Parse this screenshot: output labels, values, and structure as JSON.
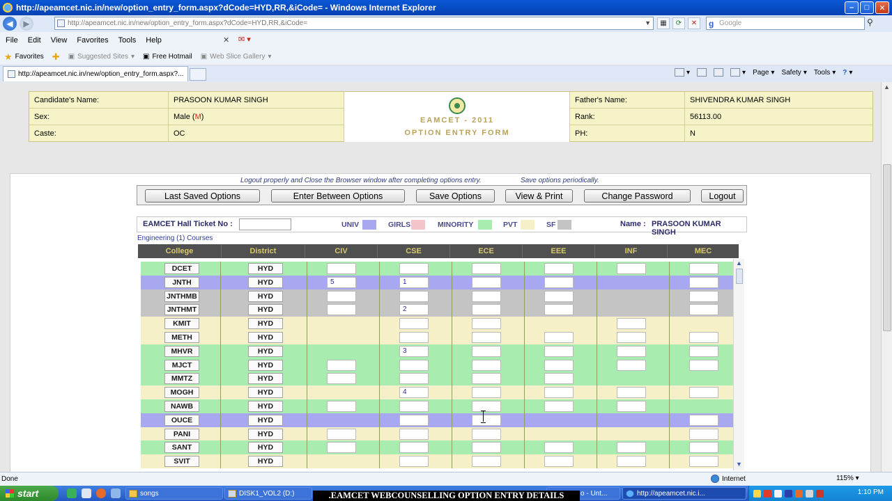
{
  "window": {
    "title": "http://apeamcet.nic.in/new/option_entry_form.aspx?dCode=HYD,RR,&iCode= - Windows Internet Explorer"
  },
  "address_bar": {
    "url": "http://apeamcet.nic.in/new/option_entry_form.aspx?dCode=HYD,RR,&iCode=",
    "search_placeholder": "Google"
  },
  "menu": [
    "File",
    "Edit",
    "View",
    "Favorites",
    "Tools",
    "Help"
  ],
  "favorites_bar": {
    "favorites": "Favorites",
    "suggested_sites": "Suggested Sites",
    "free_hotmail": "Free Hotmail",
    "web_slice_gallery": "Web Slice Gallery"
  },
  "tab": {
    "title": "http://apeamcet.nic.in/new/option_entry_form.aspx?..."
  },
  "command_bar": {
    "page": "Page",
    "safety": "Safety",
    "tools": "Tools"
  },
  "candidate": {
    "name_label": "Candidate's Name:",
    "name": "PRASOON KUMAR SINGH",
    "sex_label": "Sex:",
    "sex_value": "Male (",
    "sex_code": "M",
    "sex_close": ")",
    "caste_label": "Caste:",
    "caste": "OC",
    "father_label": "Father's Name:",
    "father": "SHIVENDRA KUMAR SINGH",
    "rank_label": "Rank:",
    "rank": "56113.00",
    "ph_label": "PH:",
    "ph": "N",
    "form_title_1": "EAMCET  -  2011",
    "form_title_2": "OPTION  ENTRY  FORM"
  },
  "notes": {
    "logout_note": "Logout properly and Close the Browser window after completing options entry.",
    "save_note": "Save options periodically."
  },
  "buttons": {
    "last_saved": "Last Saved Options",
    "enter_between": "Enter Between Options",
    "save": "Save Options",
    "view_print": "View & Print",
    "change_password": "Change Password",
    "logout": "Logout"
  },
  "info": {
    "hall_ticket_label": "EAMCET Hall Ticket No :",
    "legend": [
      {
        "label": "UNIV",
        "color": "#a8a8f0"
      },
      {
        "label": "GIRLS",
        "color": "#f5c4c8"
      },
      {
        "label": "MINORITY",
        "color": "#a8ecb0"
      },
      {
        "label": "PVT",
        "color": "#f5f0c8"
      },
      {
        "label": "SF",
        "color": "#c4c4c4"
      }
    ],
    "name_label": "Name :",
    "name": "PRASOON KUMAR SINGH",
    "courses_caption": "Engineering (1) Courses"
  },
  "grid": {
    "headers": [
      "College",
      "District",
      "CIV",
      "CSE",
      "ECE",
      "EEE",
      "INF",
      "MEC"
    ],
    "rows": [
      {
        "college": "DCET",
        "district": "HYD",
        "type": "MINORITY",
        "cells": [
          "",
          "",
          "",
          "",
          "",
          ""
        ],
        "show": [
          1,
          1,
          1,
          1,
          1,
          1
        ]
      },
      {
        "college": "JNTH",
        "district": "HYD",
        "type": "UNIV",
        "cells": [
          "5",
          "1",
          "",
          "",
          "",
          ""
        ],
        "show": [
          1,
          1,
          1,
          1,
          0,
          1
        ]
      },
      {
        "college": "JNTHMB",
        "district": "HYD",
        "type": "SF",
        "cells": [
          "",
          "",
          "",
          "",
          "",
          ""
        ],
        "show": [
          1,
          1,
          1,
          1,
          0,
          1
        ]
      },
      {
        "college": "JNTHMT",
        "district": "HYD",
        "type": "SF",
        "cells": [
          "",
          "2",
          "",
          "",
          "",
          ""
        ],
        "show": [
          1,
          1,
          1,
          1,
          0,
          1
        ]
      },
      {
        "college": "KMIT",
        "district": "HYD",
        "type": "PVT",
        "cells": [
          "",
          "",
          "",
          "",
          "",
          ""
        ],
        "show": [
          0,
          1,
          1,
          0,
          1,
          0
        ]
      },
      {
        "college": "METH",
        "district": "HYD",
        "type": "PVT",
        "cells": [
          "",
          "",
          "",
          "",
          "",
          ""
        ],
        "show": [
          0,
          1,
          1,
          1,
          1,
          1
        ]
      },
      {
        "college": "MHVR",
        "district": "HYD",
        "type": "MINORITY",
        "cells": [
          "",
          "3",
          "",
          "",
          "",
          ""
        ],
        "show": [
          0,
          1,
          1,
          1,
          1,
          1
        ]
      },
      {
        "college": "MJCT",
        "district": "HYD",
        "type": "MINORITY",
        "cells": [
          "",
          "",
          "",
          "",
          "",
          ""
        ],
        "show": [
          1,
          1,
          1,
          1,
          1,
          1
        ]
      },
      {
        "college": "MMTZ",
        "district": "HYD",
        "type": "MINORITY",
        "cells": [
          "",
          "",
          "",
          "",
          "",
          ""
        ],
        "show": [
          1,
          1,
          1,
          1,
          0,
          0
        ]
      },
      {
        "college": "MOGH",
        "district": "HYD",
        "type": "PVT",
        "cells": [
          "",
          "4",
          "",
          "",
          "",
          ""
        ],
        "show": [
          0,
          1,
          1,
          1,
          1,
          1
        ]
      },
      {
        "college": "NAWB",
        "district": "HYD",
        "type": "MINORITY",
        "cells": [
          "",
          "",
          "",
          "",
          "",
          ""
        ],
        "show": [
          1,
          1,
          1,
          1,
          1,
          0
        ]
      },
      {
        "college": "OUCE",
        "district": "HYD",
        "type": "UNIV",
        "cells": [
          "",
          "",
          "",
          "",
          "",
          ""
        ],
        "show": [
          0,
          1,
          1,
          0,
          0,
          1
        ]
      },
      {
        "college": "PANI",
        "district": "HYD",
        "type": "PVT",
        "cells": [
          "",
          "",
          "",
          "",
          "",
          ""
        ],
        "show": [
          1,
          1,
          1,
          0,
          0,
          1
        ]
      },
      {
        "college": "SANT",
        "district": "HYD",
        "type": "MINORITY",
        "cells": [
          "",
          "",
          "",
          "",
          "",
          ""
        ],
        "show": [
          1,
          1,
          1,
          1,
          1,
          1
        ]
      },
      {
        "college": "SVIT",
        "district": "HYD",
        "type": "PVT",
        "cells": [
          "",
          "",
          "",
          "",
          "",
          ""
        ],
        "show": [
          0,
          1,
          1,
          1,
          1,
          1
        ]
      }
    ]
  },
  "row_colors": {
    "UNIV": "#a8a8f0",
    "MINORITY": "#a8ecb0",
    "PVT": "#f5f0c8",
    "SF": "#c4c4c4"
  },
  "status": {
    "left": "Done",
    "zone": "Internet",
    "zoom": "115%"
  },
  "taskbar": {
    "start": "start",
    "tasks": [
      "songs",
      "DISK1_VOL2 (D:)",
      "o - Unt...",
      "http://apeamcet.nic.i..."
    ],
    "caption": ".EAMCET WEBCOUNSELLING OPTION ENTRY DETAILS",
    "clock": "1:10 PM"
  }
}
